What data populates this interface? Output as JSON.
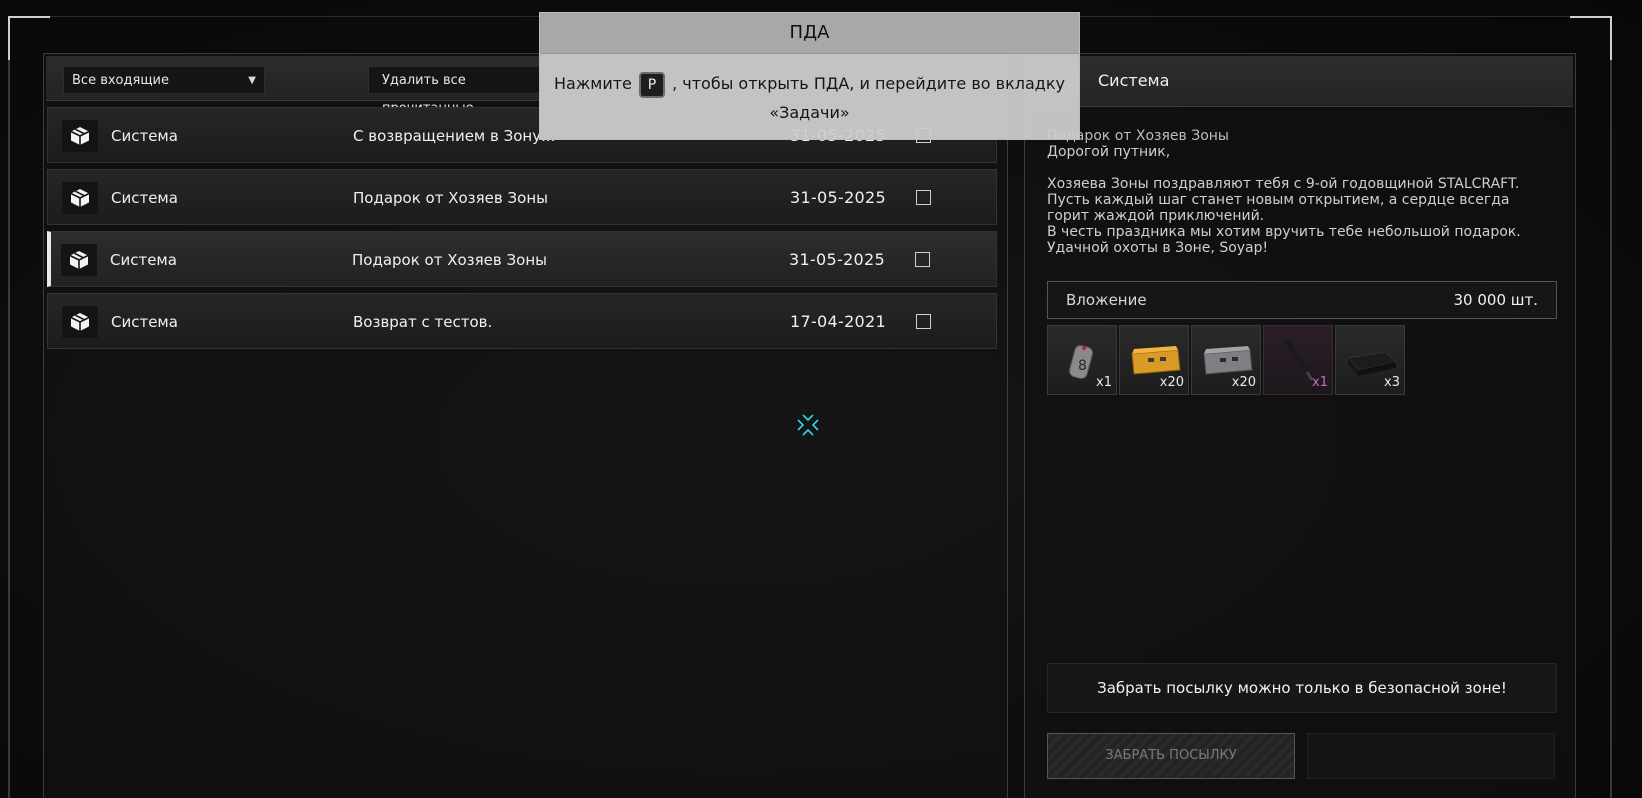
{
  "inbox": {
    "filter_label": "Все входящие",
    "delete_read_label": "Удалить все прочитанные",
    "messages": [
      {
        "sender": "Система",
        "subject": "С возвращением в Зону...",
        "date": "31-05-2025"
      },
      {
        "sender": "Система",
        "subject": "Подарок от Хозяев Зоны",
        "date": "31-05-2025"
      },
      {
        "sender": "Система",
        "subject": "Подарок от Хозяев Зоны",
        "date": "31-05-2025"
      },
      {
        "sender": "Система",
        "subject": "Возврат с тестов.",
        "date": "17-04-2021"
      }
    ]
  },
  "detail": {
    "sender": "Система",
    "title": "Подарок от Хозяев Зоны",
    "greeting": "Дорогой путник,",
    "lines": [
      "Хозяева Зоны поздравляют тебя с 9-ой годовщиной STALCRAFT.",
      "Пусть каждый шаг станет новым открытием, а сердце всегда горит жаждой приключений.",
      "В честь праздника мы хотим вручить тебе небольшой подарок.",
      "Удачной охоты в Зоне, Soyap!"
    ],
    "attachment_label": "Вложение",
    "attachment_amount": "30 000 шт.",
    "items": [
      {
        "icon": "dog-tag-icon",
        "qty": "x1"
      },
      {
        "icon": "yellow-case-icon",
        "qty": "x20"
      },
      {
        "icon": "grey-case-icon",
        "qty": "x20"
      },
      {
        "icon": "pickaxe-icon",
        "qty": "x1",
        "rarity_color": "#c86ac0"
      },
      {
        "icon": "black-box-icon",
        "qty": "x3"
      }
    ],
    "warning": "Забрать посылку можно только в безопасной зоне!",
    "claim_label": "ЗАБРАТЬ ПОСЫЛКУ"
  },
  "pda_hint": {
    "title": "ПДА",
    "prefix": "Нажмите",
    "key": "P",
    "suffix": ", чтобы открыть ПДА, и перейдите во вкладку",
    "tab": "«Задачи»"
  }
}
